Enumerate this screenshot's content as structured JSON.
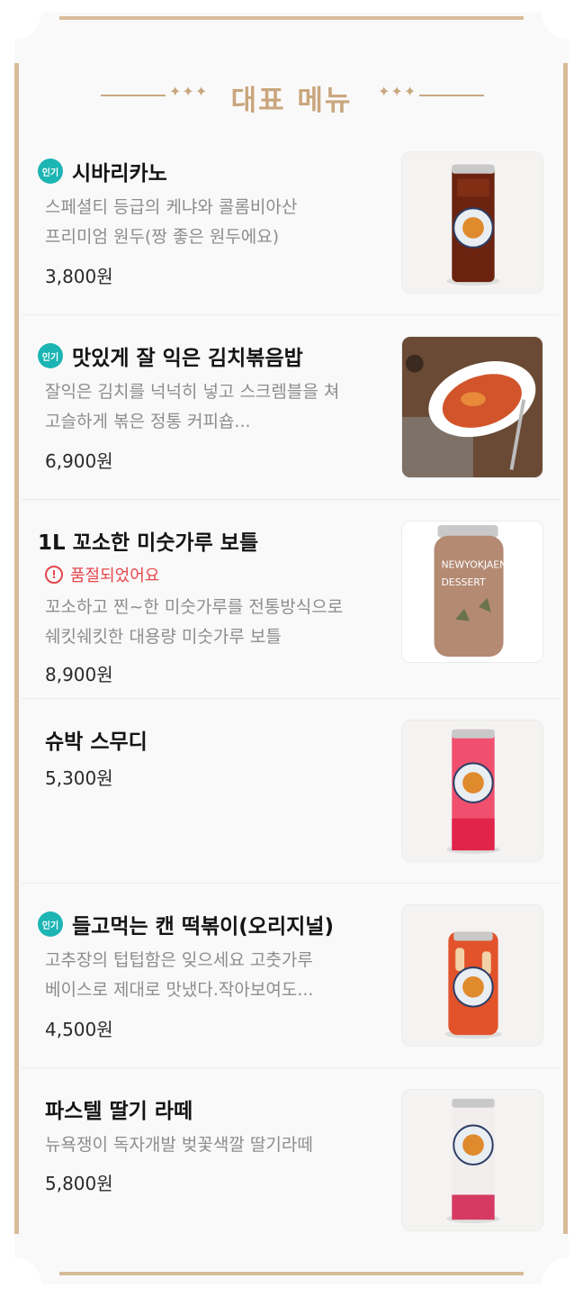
{
  "section": {
    "title": "대표 메뉴",
    "sparkle_left": "✦✦✦",
    "sparkle_right": "✦✦✦"
  },
  "colors": {
    "accent": "#c9a67d",
    "frame": "#d7bc98",
    "badge": "#1cb5b3",
    "soldout": "#e5484d"
  },
  "menu": [
    {
      "badge": "인기",
      "name": "시바리카노",
      "desc1": "스페셜티 등급의 케냐와 콜롬비아산",
      "desc2": "프리미엄 원두(짱 좋은 원두에요)",
      "price": "3,800원",
      "image_icon": "iced-americano-can-icon"
    },
    {
      "badge": "인기",
      "name": "맛있게 잘 익은 김치볶음밥",
      "desc1": "잘익은 김치를 넉넉히 넣고 스크렘블을 쳐",
      "desc2": "고슬하게 볶은 정통 커피숍...",
      "price": "6,900원",
      "image_icon": "kimchi-fried-rice-plate-icon"
    },
    {
      "name": "1L 꼬소한 미숫가루 보틀",
      "soldout": "품절되었어요",
      "desc1": "꼬소하고 찐~한 미숫가루를 전통방식으로",
      "desc2": "쉐킷쉐킷한 대용량 미숫가루 보틀",
      "price": "8,900원",
      "image_icon": "misutgaru-bottle-icon",
      "bottle_label_1": "NEWYOKJAENG",
      "bottle_label_2": "DESSERT"
    },
    {
      "name": "슈박 스무디",
      "price": "5,300원",
      "image_icon": "watermelon-smoothie-can-icon"
    },
    {
      "badge": "인기",
      "name": "들고먹는 캔 떡볶이(오리지널)",
      "desc1": "고추장의 텁텁함은 잊으세요 고춧가루",
      "desc2": "베이스로 제대로 맛냈다.작아보여도...",
      "price": "4,500원",
      "image_icon": "tteokbokki-can-icon"
    },
    {
      "name": "파스텔 딸기 라떼",
      "desc1": "뉴욕쟁이 독자개발 벚꽃색깔 딸기라떼",
      "price": "5,800원",
      "image_icon": "strawberry-latte-can-icon"
    }
  ]
}
